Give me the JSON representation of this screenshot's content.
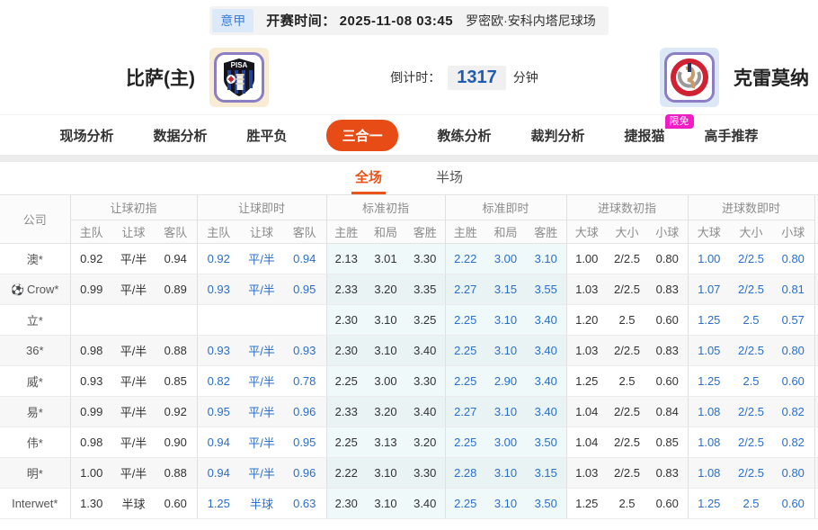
{
  "colors": {
    "accent": "#e74c17",
    "accent2": "#e8541c",
    "live_blue": "#2b6fc8",
    "badge_pink": "#ef1dc3"
  },
  "meta": {
    "league": "意甲",
    "kickoff_label": "开赛时间：",
    "kickoff_time": "2025-11-08 03:45",
    "venue": "罗密欧·安科内塔尼球场"
  },
  "teams": {
    "home_name": "比萨(主)",
    "away_name": "克雷莫纳",
    "countdown_label": "倒计时：",
    "countdown_value": "1317",
    "countdown_unit": "分钟"
  },
  "icons": {
    "soccer_ball": "⚽"
  },
  "nav": {
    "tabs": [
      {
        "label": "现场分析",
        "active": false
      },
      {
        "label": "数据分析",
        "active": false
      },
      {
        "label": "胜平负",
        "active": false
      },
      {
        "label": "三合一",
        "active": true
      },
      {
        "label": "教练分析",
        "active": false
      },
      {
        "label": "裁判分析",
        "active": false
      },
      {
        "label": "捷报猫",
        "active": false,
        "badge": "限免"
      },
      {
        "label": "高手推荐",
        "active": false
      }
    ]
  },
  "subtabs": [
    {
      "label": "全场",
      "active": true
    },
    {
      "label": "半场",
      "active": false
    }
  ],
  "table": {
    "company_header": "公司",
    "groups": [
      {
        "label": "让球初指",
        "cols": [
          "主队",
          "让球",
          "客队"
        ]
      },
      {
        "label": "让球即时",
        "cols": [
          "主队",
          "让球",
          "客队"
        ]
      },
      {
        "label": "标准初指",
        "cols": [
          "主胜",
          "和局",
          "客胜"
        ]
      },
      {
        "label": "标准即时",
        "cols": [
          "主胜",
          "和局",
          "客胜"
        ]
      },
      {
        "label": "进球数初指",
        "cols": [
          "大球",
          "大小",
          "小球"
        ]
      },
      {
        "label": "进球数即时",
        "cols": [
          "大球",
          "大小",
          "小球"
        ]
      }
    ],
    "rows": [
      {
        "company": "澳*",
        "icon": false,
        "hi": [
          "0.92",
          "平/半",
          "0.94"
        ],
        "hl": [
          "0.92",
          "平/半",
          "0.94"
        ],
        "si": [
          "2.13",
          "3.01",
          "3.30"
        ],
        "sl": [
          "2.22",
          "3.00",
          "3.10"
        ],
        "gi": [
          "1.00",
          "2/2.5",
          "0.80"
        ],
        "gl": [
          "1.00",
          "2/2.5",
          "0.80"
        ]
      },
      {
        "company": "Crow*",
        "icon": true,
        "hi": [
          "0.99",
          "平/半",
          "0.89"
        ],
        "hl": [
          "0.93",
          "平/半",
          "0.95"
        ],
        "si": [
          "2.33",
          "3.20",
          "3.35"
        ],
        "sl": [
          "2.27",
          "3.15",
          "3.55"
        ],
        "gi": [
          "1.03",
          "2/2.5",
          "0.83"
        ],
        "gl": [
          "1.07",
          "2/2.5",
          "0.81"
        ]
      },
      {
        "company": "立*",
        "icon": false,
        "hi": [
          "",
          "",
          ""
        ],
        "hl": [
          "",
          "",
          ""
        ],
        "si": [
          "2.30",
          "3.10",
          "3.25"
        ],
        "sl": [
          "2.25",
          "3.10",
          "3.40"
        ],
        "gi": [
          "1.20",
          "2.5",
          "0.60"
        ],
        "gl": [
          "1.25",
          "2.5",
          "0.57"
        ]
      },
      {
        "company": "36*",
        "icon": false,
        "hi": [
          "0.98",
          "平/半",
          "0.88"
        ],
        "hl": [
          "0.93",
          "平/半",
          "0.93"
        ],
        "si": [
          "2.30",
          "3.10",
          "3.40"
        ],
        "sl": [
          "2.25",
          "3.10",
          "3.40"
        ],
        "gi": [
          "1.03",
          "2/2.5",
          "0.83"
        ],
        "gl": [
          "1.05",
          "2/2.5",
          "0.80"
        ]
      },
      {
        "company": "威*",
        "icon": false,
        "hi": [
          "0.93",
          "平/半",
          "0.85"
        ],
        "hl": [
          "0.82",
          "平/半",
          "0.78"
        ],
        "si": [
          "2.25",
          "3.00",
          "3.30"
        ],
        "sl": [
          "2.25",
          "2.90",
          "3.40"
        ],
        "gi": [
          "1.25",
          "2.5",
          "0.60"
        ],
        "gl": [
          "1.25",
          "2.5",
          "0.60"
        ]
      },
      {
        "company": "易*",
        "icon": false,
        "hi": [
          "0.99",
          "平/半",
          "0.92"
        ],
        "hl": [
          "0.95",
          "平/半",
          "0.96"
        ],
        "si": [
          "2.33",
          "3.20",
          "3.40"
        ],
        "sl": [
          "2.27",
          "3.10",
          "3.40"
        ],
        "gi": [
          "1.04",
          "2/2.5",
          "0.84"
        ],
        "gl": [
          "1.08",
          "2/2.5",
          "0.82"
        ]
      },
      {
        "company": "伟*",
        "icon": false,
        "hi": [
          "0.98",
          "平/半",
          "0.90"
        ],
        "hl": [
          "0.94",
          "平/半",
          "0.95"
        ],
        "si": [
          "2.25",
          "3.13",
          "3.20"
        ],
        "sl": [
          "2.25",
          "3.00",
          "3.50"
        ],
        "gi": [
          "1.04",
          "2/2.5",
          "0.85"
        ],
        "gl": [
          "1.08",
          "2/2.5",
          "0.82"
        ]
      },
      {
        "company": "明*",
        "icon": false,
        "hi": [
          "1.00",
          "平/半",
          "0.88"
        ],
        "hl": [
          "0.94",
          "平/半",
          "0.96"
        ],
        "si": [
          "2.22",
          "3.10",
          "3.30"
        ],
        "sl": [
          "2.28",
          "3.10",
          "3.15"
        ],
        "gi": [
          "1.03",
          "2/2.5",
          "0.83"
        ],
        "gl": [
          "1.08",
          "2/2.5",
          "0.80"
        ]
      },
      {
        "company": "Interwet*",
        "icon": false,
        "hi": [
          "1.30",
          "半球",
          "0.60"
        ],
        "hl": [
          "1.25",
          "半球",
          "0.63"
        ],
        "si": [
          "2.30",
          "3.10",
          "3.40"
        ],
        "sl": [
          "2.25",
          "3.10",
          "3.50"
        ],
        "gi": [
          "1.25",
          "2.5",
          "0.60"
        ],
        "gl": [
          "1.25",
          "2.5",
          "0.60"
        ]
      }
    ]
  }
}
